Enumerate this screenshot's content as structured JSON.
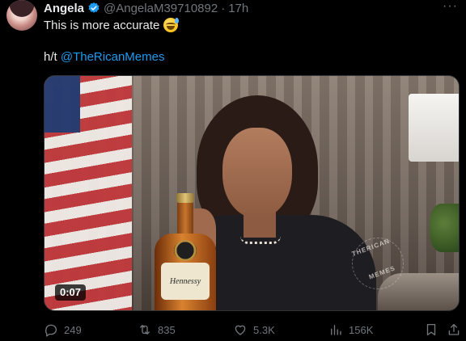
{
  "tweet": {
    "author_name": "Angela",
    "handle": "@AngelaM39710892",
    "separator": "·",
    "time": "17h",
    "more_label": "···",
    "text_line1": "This is more accurate",
    "credit_prefix": "h/t",
    "credit_mention": "@TheRicanMemes"
  },
  "media": {
    "duration": "0:07",
    "bottle_label": "Hennessy",
    "watermark_line1": "THERICAN",
    "watermark_line2": "MEMES"
  },
  "actions": {
    "replies": "249",
    "reposts": "835",
    "likes": "5.3K",
    "views": "156K"
  },
  "icons": {
    "verified": "verified-badge-icon",
    "reply": "reply-icon",
    "repost": "repost-icon",
    "like": "heart-icon",
    "views": "views-chart-icon",
    "bookmark": "bookmark-icon",
    "share": "share-icon"
  },
  "colors": {
    "background": "#000000",
    "text": "#e7e9ea",
    "muted": "#71767b",
    "accent": "#1d9bf0"
  }
}
